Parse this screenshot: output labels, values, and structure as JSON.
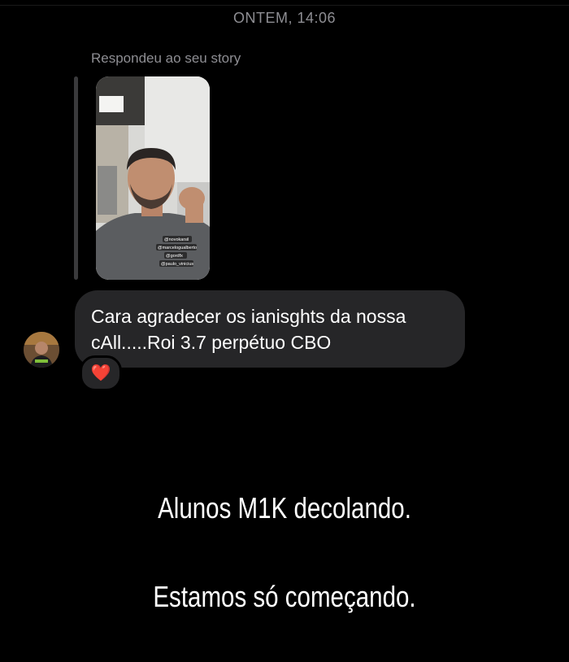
{
  "conversation": {
    "timestamp": "ONTEM, 14:06"
  },
  "reply": {
    "label": "Respondeu ao seu story",
    "story_tags": [
      "@novokarsil",
      "@marcelogualberto",
      "@gordfx",
      "@paulo_vinicius"
    ]
  },
  "message": {
    "text": "Cara agradecer os ianisghts da nossa cAll.....Roi 3.7 perpétuo CBO",
    "reaction": "❤️"
  },
  "overlay": {
    "line1": "Alunos M1K decolando.",
    "line2": "Estamos só começando."
  }
}
